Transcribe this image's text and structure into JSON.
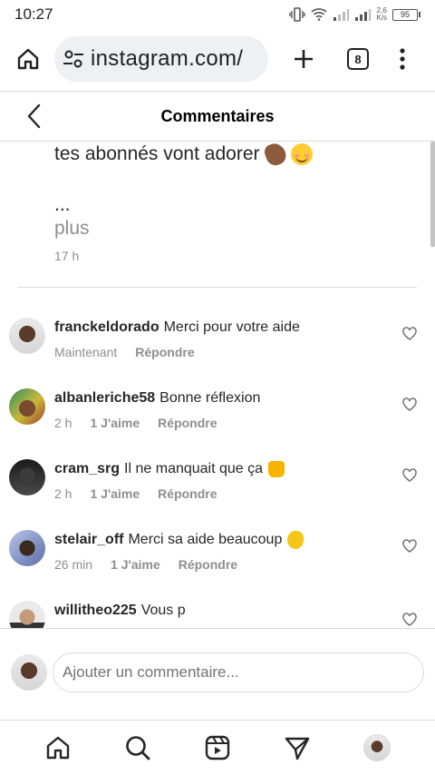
{
  "status_bar": {
    "time": "10:27",
    "net_speed_value": "2,6",
    "net_speed_unit": "K/s",
    "battery": "95"
  },
  "browser": {
    "url": "instagram.com/",
    "tab_count": "8"
  },
  "header": {
    "title": "Commentaires"
  },
  "caption": {
    "text_tail": "tes abonnés vont adorer",
    "ellipsis": "...",
    "more": "plus",
    "time": "17 h"
  },
  "comments": [
    {
      "user": "franckeldorado",
      "text": "Merci pour votre aide",
      "time": "Maintenant",
      "likes": "",
      "reply": "Répondre"
    },
    {
      "user": "albanleriche58",
      "text": "Bonne réflexion",
      "time": "2 h",
      "likes": "1 J'aime",
      "reply": "Répondre"
    },
    {
      "user": "cram_srg",
      "text": "Il ne manquait que ça",
      "time": "2 h",
      "likes": "1 J'aime",
      "reply": "Répondre"
    },
    {
      "user": "stelair_off",
      "text": "Merci sa aide beaucoup",
      "time": "26 min",
      "likes": "1 J'aime",
      "reply": "Répondre"
    },
    {
      "user": "willitheo225",
      "text": "Vous p",
      "time": "",
      "likes": "",
      "reply": ""
    }
  ],
  "comment_input": {
    "placeholder": "Ajouter un commentaire..."
  },
  "bottom_nav": [
    "home-icon",
    "search-icon",
    "reels-icon",
    "direct-message-icon",
    "profile-avatar"
  ]
}
